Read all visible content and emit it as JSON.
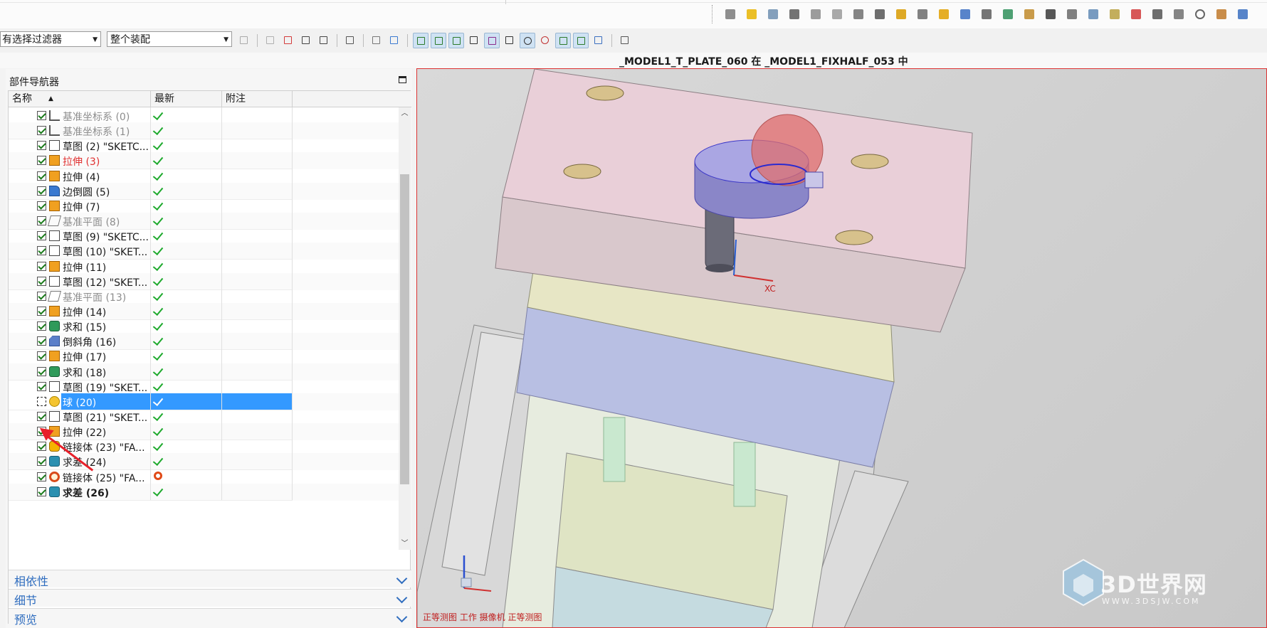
{
  "toolbar": {
    "filter_value": "没有选择过滤器",
    "filter_value_visible": "有选择过滤器",
    "assembly_scope": "整个装配"
  },
  "view": {
    "title": "_MODEL1_T_PLATE_060 在 _MODEL1_FIXHALF_053 中",
    "status": "正等测图 工作 摄像机 正等测图",
    "wcs_label": "XC"
  },
  "navigator": {
    "title": "部件导航器",
    "columns": {
      "name": "名称",
      "latest": "最新",
      "note": "附注"
    },
    "rows": [
      {
        "label": "基准坐标系 (0)",
        "icon": "datum-csys-icon",
        "style": "grey",
        "status": "ok"
      },
      {
        "label": "基准坐标系 (1)",
        "icon": "datum-csys-icon",
        "style": "grey",
        "status": "ok"
      },
      {
        "label": "草图 (2) \"SKETC...",
        "icon": "sketch-icon",
        "style": "",
        "status": "ok"
      },
      {
        "label": "拉伸 (3)",
        "icon": "extrude-icon",
        "style": "red",
        "status": "ok"
      },
      {
        "label": "拉伸 (4)",
        "icon": "extrude-icon",
        "style": "",
        "status": "ok"
      },
      {
        "label": "边倒圆 (5)",
        "icon": "edge-blend-icon",
        "style": "",
        "status": "ok"
      },
      {
        "label": "拉伸 (7)",
        "icon": "extrude-icon",
        "style": "",
        "status": "ok"
      },
      {
        "label": "基准平面 (8)",
        "icon": "datum-plane-icon",
        "style": "grey",
        "status": "ok"
      },
      {
        "label": "草图 (9) \"SKETC...",
        "icon": "sketch-icon",
        "style": "",
        "status": "ok"
      },
      {
        "label": "草图 (10) \"SKET...",
        "icon": "sketch-icon",
        "style": "",
        "status": "ok"
      },
      {
        "label": "拉伸 (11)",
        "icon": "extrude-icon",
        "style": "",
        "status": "ok"
      },
      {
        "label": "草图 (12) \"SKET...",
        "icon": "sketch-icon",
        "style": "",
        "status": "ok"
      },
      {
        "label": "基准平面 (13)",
        "icon": "datum-plane-icon",
        "style": "grey",
        "status": "ok"
      },
      {
        "label": "拉伸 (14)",
        "icon": "extrude-icon",
        "style": "",
        "status": "ok"
      },
      {
        "label": "求和 (15)",
        "icon": "unite-icon",
        "style": "",
        "status": "ok"
      },
      {
        "label": "倒斜角 (16)",
        "icon": "chamfer-icon",
        "style": "",
        "status": "ok"
      },
      {
        "label": "拉伸 (17)",
        "icon": "extrude-icon",
        "style": "",
        "status": "ok"
      },
      {
        "label": "求和 (18)",
        "icon": "unite-icon",
        "style": "",
        "status": "ok"
      },
      {
        "label": "草图 (19) \"SKET...",
        "icon": "sketch-icon",
        "style": "",
        "status": "ok"
      },
      {
        "label": "球 (20)",
        "icon": "sphere-icon",
        "style": "selected",
        "status": "ok"
      },
      {
        "label": "草图 (21) \"SKET...",
        "icon": "sketch-icon",
        "style": "",
        "status": "ok"
      },
      {
        "label": "拉伸 (22)",
        "icon": "extrude-icon",
        "style": "",
        "status": "ok"
      },
      {
        "label": "链接体 (23) \"FA...",
        "icon": "linked-body-icon",
        "style": "",
        "status": "ok"
      },
      {
        "label": "求差 (24)",
        "icon": "subtract-icon",
        "style": "",
        "status": "ok"
      },
      {
        "label": "链接体 (25) \"FA...",
        "icon": "linked-body-update-icon",
        "style": "",
        "status": "update"
      },
      {
        "label": "求差 (26)",
        "icon": "subtract-icon",
        "style": "bold",
        "status": "ok"
      }
    ],
    "panels": [
      "相依性",
      "细节",
      "预览"
    ]
  },
  "watermark": {
    "brand": "3D世界网",
    "url": "WWW.3DSJW.COM"
  },
  "colors": {
    "selection": "#3399ff",
    "check_green": "#1faa2e",
    "link_blue": "#2f6dbf",
    "annotation_red": "#e8202a"
  }
}
